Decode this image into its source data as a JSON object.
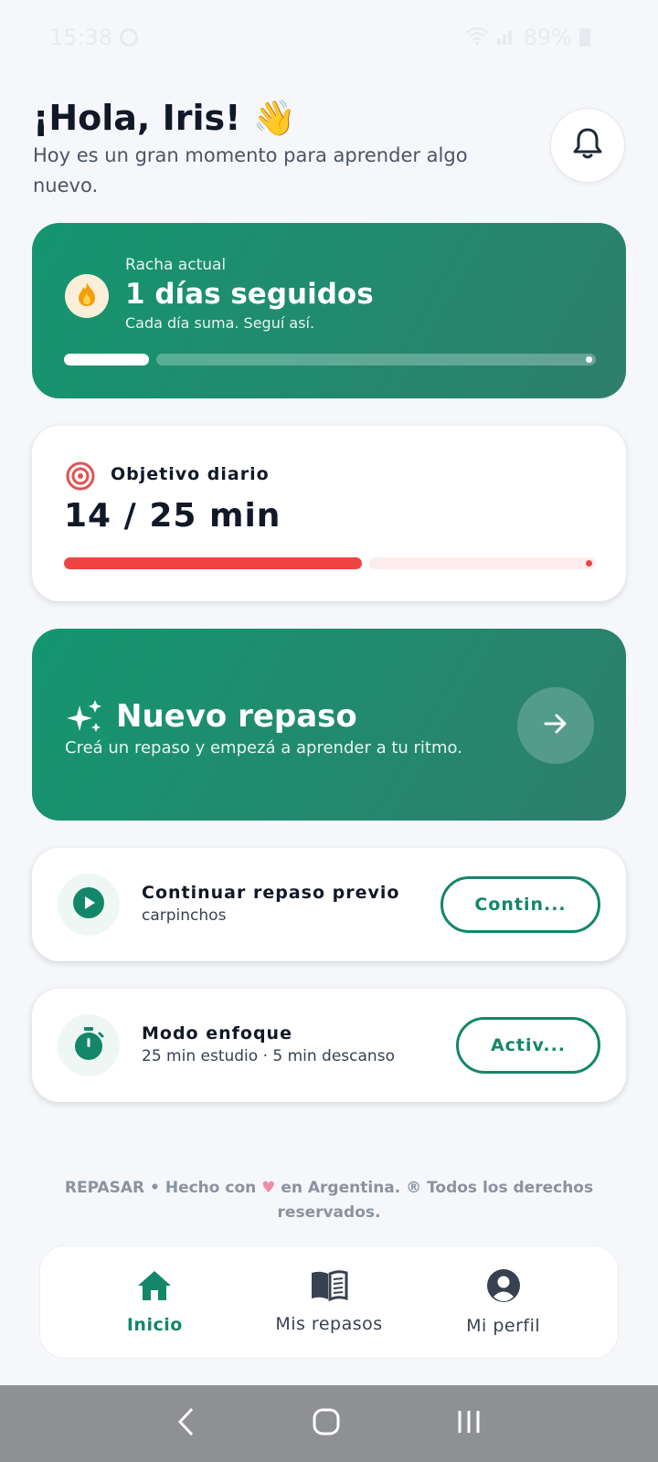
{
  "status_bar": {
    "time": "15:38",
    "battery": "89%"
  },
  "greeting": {
    "title": "¡Hola, Iris! 👋",
    "subtitle": "Hoy es un gran momento para aprender algo nuevo."
  },
  "streak": {
    "label": "Racha actual",
    "value": "1 días seguidos",
    "subtitle": "Cada día suma. Seguí así.",
    "progress_fraction": 0.16
  },
  "daily_goal": {
    "label": "Objetivo diario",
    "value": "14 / 25 min",
    "progress_fraction": 0.56
  },
  "new_review": {
    "title": "Nuevo repaso",
    "subtitle": "Creá un repaso y empezá a aprender a tu ritmo."
  },
  "continue_review": {
    "title": "Continuar repaso previo",
    "subtitle": "carpinchos",
    "button_label": "Contin..."
  },
  "focus_mode": {
    "title": "Modo enfoque",
    "subtitle": "25 min estudio · 5 min descanso",
    "button_label": "Activ..."
  },
  "footer": {
    "prefix": "REPASAR • Hecho con",
    "suffix": "en Argentina. ® Todos los derechos reservados."
  },
  "bottom_nav": {
    "items": [
      {
        "label": "Inicio",
        "icon": "home-icon",
        "active": true
      },
      {
        "label": "Mis repasos",
        "icon": "book-icon",
        "active": false
      },
      {
        "label": "Mi perfil",
        "icon": "user-icon",
        "active": false
      }
    ]
  },
  "colors": {
    "accent_green": "#14866a",
    "goal_red": "#ef4444",
    "background": "#f5f7fa"
  }
}
